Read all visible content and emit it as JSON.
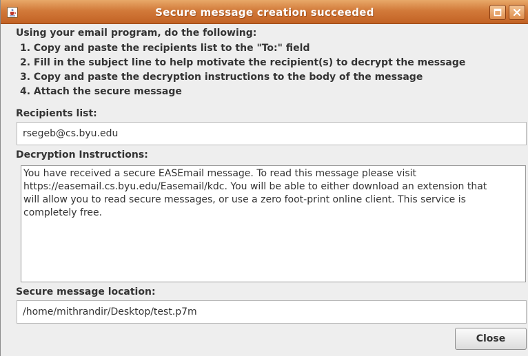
{
  "window": {
    "title": "Secure message creation succeeded"
  },
  "instructions": {
    "heading": "Using your email program, do the following:",
    "steps": [
      "1. Copy and paste the recipients list to the \"To:\" field",
      "2. Fill in the subject line to help motivate the recipient(s) to decrypt the message",
      "3. Copy and paste the decryption instructions to the body of the message",
      "4. Attach the secure message"
    ]
  },
  "recipients": {
    "label": "Recipients list:",
    "value": "rsegeb@cs.byu.edu"
  },
  "decryption": {
    "label": "Decryption Instructions:",
    "lines": [
      "You have received a secure EASEmail message. To read this message please visit",
      "https://easemail.cs.byu.edu/Easemail/kdc. You will be able to either download an extension that",
      "will allow you to read secure messages, or use a zero foot-print online client. This service is",
      "completely free."
    ]
  },
  "location": {
    "label": "Secure message location:",
    "value": "/home/mithrandir/Desktop/test.p7m"
  },
  "buttons": {
    "close": "Close"
  },
  "icons": {
    "app": "java-cup-icon",
    "maximize": "maximize-icon",
    "close": "close-icon"
  },
  "colors": {
    "titlebar": "#d27a3a",
    "background": "#eeeeee",
    "text": "#333333"
  }
}
